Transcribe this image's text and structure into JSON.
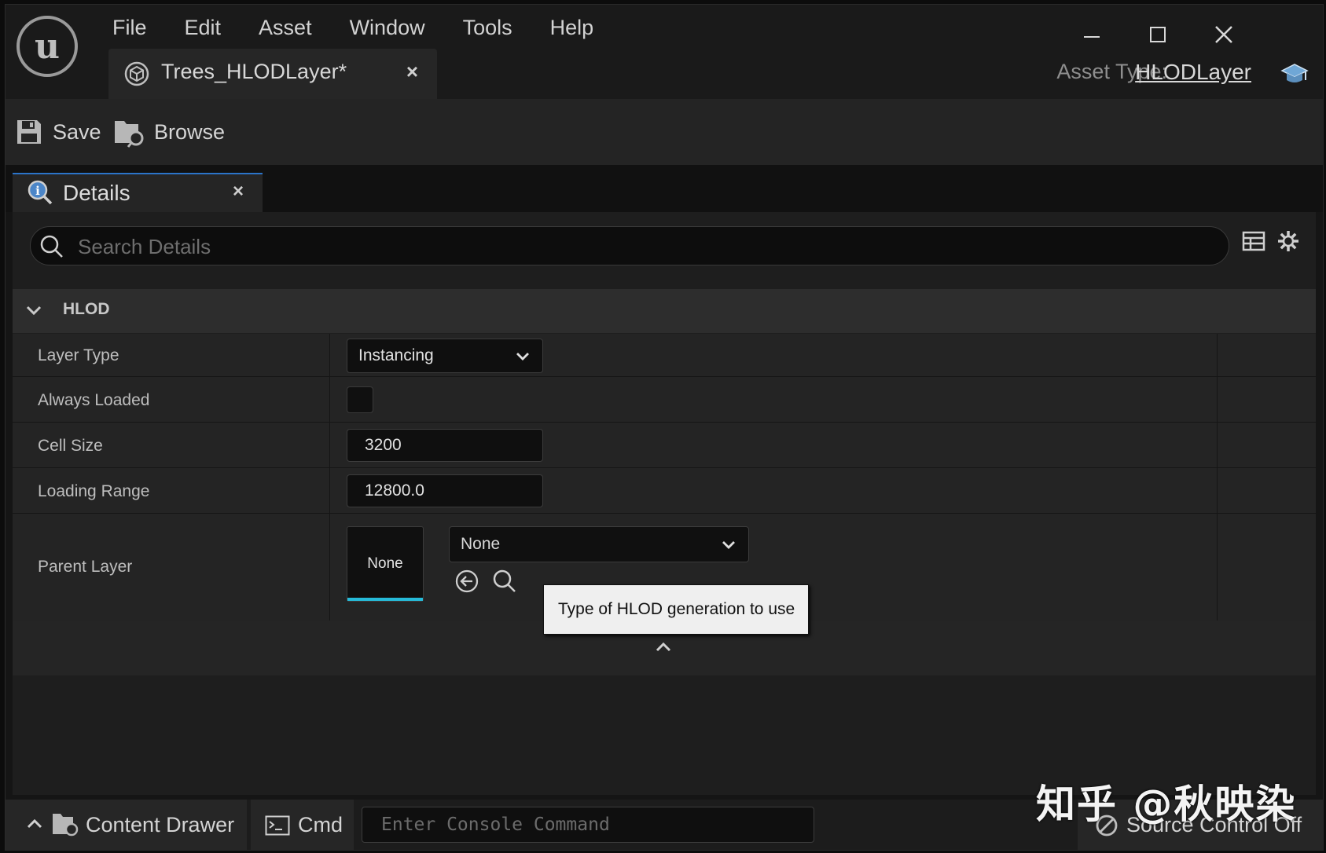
{
  "app": {
    "logo_letter": "u"
  },
  "menu": [
    "File",
    "Edit",
    "Asset",
    "Window",
    "Tools",
    "Help"
  ],
  "document_tab": {
    "label": "Trees_HLODLayer*",
    "close": "×"
  },
  "asset_type": {
    "label": "Asset Type:",
    "value": "HLODLayer"
  },
  "toolbar": {
    "save_label": "Save",
    "browse_label": "Browse"
  },
  "details_tab": {
    "label": "Details",
    "close": "×"
  },
  "search": {
    "placeholder": "Search Details",
    "value": ""
  },
  "category": {
    "label": "HLOD",
    "expanded": true
  },
  "properties": {
    "layer_type": {
      "label": "Layer Type",
      "value": "Instancing"
    },
    "always_loaded": {
      "label": "Always Loaded",
      "checked": false
    },
    "cell_size": {
      "label": "Cell Size",
      "value": "3200"
    },
    "loading_range": {
      "label": "Loading Range",
      "value": "12800.0"
    },
    "parent_layer": {
      "label": "Parent Layer",
      "thumbnail": "None",
      "value": "None"
    }
  },
  "tooltip": {
    "text": "Type of HLOD generation to use"
  },
  "statusbar": {
    "content_drawer": "Content Drawer",
    "cmd": "Cmd",
    "console_placeholder": "Enter Console Command",
    "source_control": "Source Control Off"
  },
  "watermark": "知乎 @秋映染",
  "colors": {
    "accent_blue": "#2b74c9",
    "thumb_bar": "#26bbd9",
    "background": "#151515"
  }
}
